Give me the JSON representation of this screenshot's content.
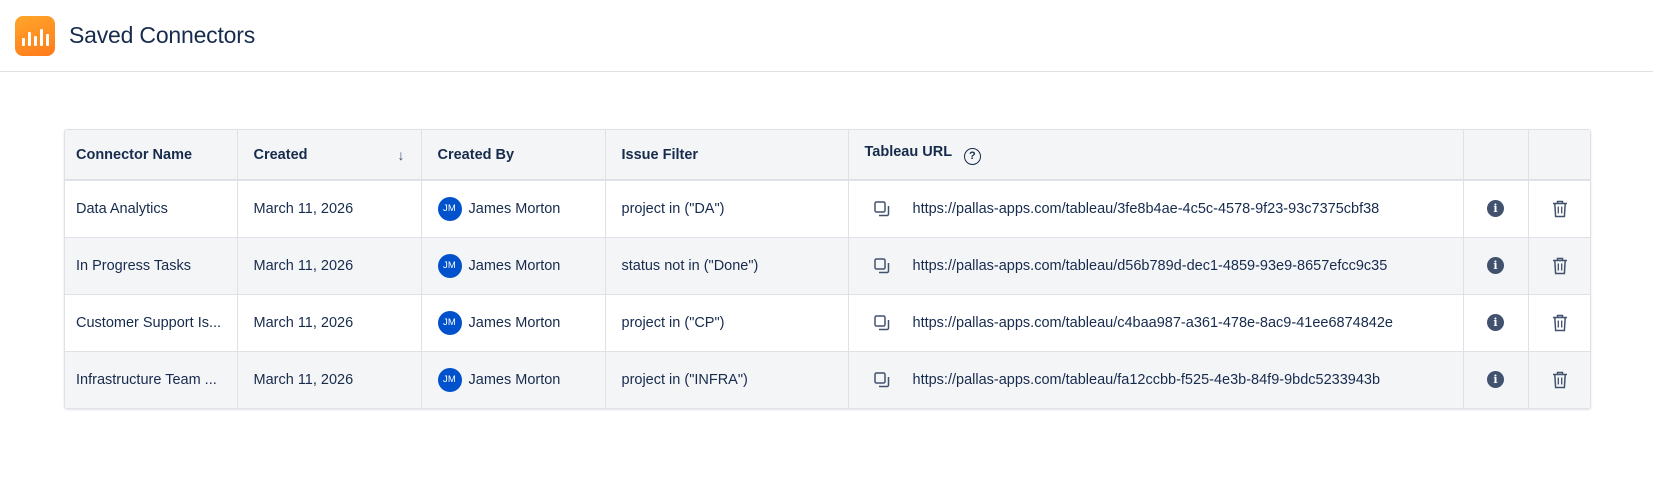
{
  "header": {
    "title": "Saved Connectors",
    "logo_icon": "bar-chart-logo",
    "logo_color": "#ff8a1f"
  },
  "table": {
    "columns": {
      "name": "Connector Name",
      "created": "Created",
      "created_by": "Created By",
      "issue_filter": "Issue Filter",
      "tableau_url": "Tableau URL"
    },
    "sort_icon": "arrow-down-icon",
    "rows": [
      {
        "name": "Data Analytics",
        "created": "March 11, 2026",
        "initials": "JM",
        "created_by": "James Morton",
        "issue_filter": "project in (\"DA\")",
        "tableau_url": "https://pallas-apps.com/tableau/3fe8b4ae-4c5c-4578-9f23-93c7375cbf38"
      },
      {
        "name": "In Progress Tasks",
        "created": "March 11, 2026",
        "initials": "JM",
        "created_by": "James Morton",
        "issue_filter": "status not in (\"Done\")",
        "tableau_url": "https://pallas-apps.com/tableau/d56b789d-dec1-4859-93e9-8657efcc9c35"
      },
      {
        "name": "Customer Support Is...",
        "created": "March 11, 2026",
        "initials": "JM",
        "created_by": "James Morton",
        "issue_filter": "project in (\"CP\")",
        "tableau_url": "https://pallas-apps.com/tableau/c4baa987-a361-478e-8ac9-41ee6874842e"
      },
      {
        "name": "Infrastructure Team ...",
        "created": "March 11, 2026",
        "initials": "JM",
        "created_by": "James Morton",
        "issue_filter": "project in (\"INFRA\")",
        "tableau_url": "https://pallas-apps.com/tableau/fa12ccbb-f525-4e3b-84f9-9bdc5233943b"
      }
    ]
  },
  "colors": {
    "avatar": "#0052cc",
    "header_bg": "#f4f5f7",
    "text": "#172b4d"
  }
}
